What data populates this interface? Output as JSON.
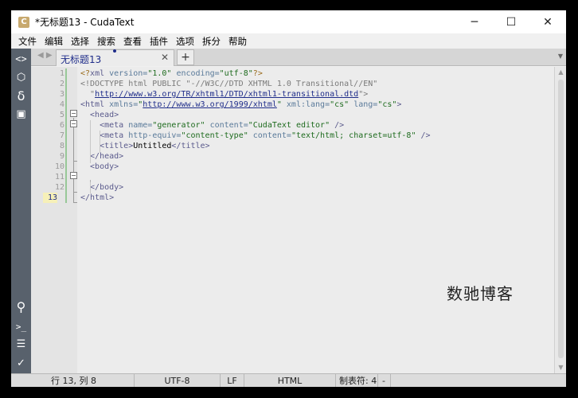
{
  "window": {
    "title": "*无标题13 - CudaText",
    "minimize_glyph": "─",
    "maximize_glyph": "☐",
    "close_glyph": "✕",
    "app_icon_letter": "C"
  },
  "menu": [
    "文件",
    "编辑",
    "选择",
    "搜索",
    "查看",
    "插件",
    "选项",
    "拆分",
    "帮助"
  ],
  "left_toolbar": {
    "top_icons": [
      {
        "name": "code-tree-icon",
        "glyph": "<>"
      },
      {
        "name": "project-icon",
        "glyph": "⬡"
      },
      {
        "name": "snippets-icon",
        "glyph": "δ"
      },
      {
        "name": "tabs-panel-icon",
        "glyph": "▣"
      }
    ],
    "bottom_icons": [
      {
        "name": "search-icon",
        "glyph": "⚲"
      },
      {
        "name": "console-icon",
        "glyph": ">_"
      },
      {
        "name": "output-icon",
        "glyph": "☰"
      },
      {
        "name": "validate-icon",
        "glyph": "✓"
      }
    ]
  },
  "tabs": {
    "nav_left": "◀",
    "nav_right": "▶",
    "active_label": "无标题13",
    "close_glyph": "✕",
    "add_glyph": "+",
    "more_glyph": "▼"
  },
  "editor": {
    "line_numbers": [
      "1",
      "2",
      "3",
      "4",
      "5",
      "6",
      "7",
      "8",
      "9",
      "10",
      "11",
      "12",
      "13"
    ],
    "current_line": "13",
    "lines": [
      [
        {
          "c": "t-pi",
          "t": "<?"
        },
        {
          "c": "t-tag",
          "t": "xml "
        },
        {
          "c": "t-attr",
          "t": "version="
        },
        {
          "c": "t-val",
          "t": "\"1.0\""
        },
        {
          "c": "t-attr",
          "t": " encoding="
        },
        {
          "c": "t-val",
          "t": "\"utf-8\""
        },
        {
          "c": "t-pi",
          "t": "?>"
        }
      ],
      [
        {
          "c": "t-doc",
          "t": "<!DOCTYPE html PUBLIC \"-//W3C//DTD XHTML 1.0 Transitional//EN\""
        }
      ],
      [
        {
          "c": "t-doc",
          "t": "  \""
        },
        {
          "c": "t-url",
          "t": "http://www.w3.org/TR/xhtml1/DTD/xhtml1-transitional.dtd"
        },
        {
          "c": "t-doc",
          "t": "\">"
        }
      ],
      [
        {
          "c": "t-tag",
          "t": "<html "
        },
        {
          "c": "t-attr",
          "t": "xmlns="
        },
        {
          "c": "t-val",
          "t": "\""
        },
        {
          "c": "t-url",
          "t": "http://www.w3.org/1999/xhtml"
        },
        {
          "c": "t-val",
          "t": "\""
        },
        {
          "c": "t-attr",
          "t": " xml:lang="
        },
        {
          "c": "t-val",
          "t": "\"cs\""
        },
        {
          "c": "t-attr",
          "t": " lang="
        },
        {
          "c": "t-val",
          "t": "\"cs\""
        },
        {
          "c": "t-tag",
          "t": ">"
        }
      ],
      [
        {
          "c": "t-tag",
          "t": "  <head>"
        }
      ],
      [
        {
          "c": "t-tag",
          "t": "    <meta "
        },
        {
          "c": "t-attr",
          "t": "name="
        },
        {
          "c": "t-val",
          "t": "\"generator\""
        },
        {
          "c": "t-attr",
          "t": " content="
        },
        {
          "c": "t-val",
          "t": "\"CudaText editor\""
        },
        {
          "c": "t-tag",
          "t": " />"
        }
      ],
      [
        {
          "c": "t-tag",
          "t": "    <meta "
        },
        {
          "c": "t-attr",
          "t": "http-equiv="
        },
        {
          "c": "t-val",
          "t": "\"content-type\""
        },
        {
          "c": "t-attr",
          "t": " content="
        },
        {
          "c": "t-val",
          "t": "\"text/html; charset=utf-8\""
        },
        {
          "c": "t-tag",
          "t": " />"
        }
      ],
      [
        {
          "c": "t-tag",
          "t": "    <title>"
        },
        {
          "c": "t-txt",
          "t": "Untitled"
        },
        {
          "c": "t-tag",
          "t": "</title>"
        }
      ],
      [
        {
          "c": "t-tag",
          "t": "  </head>"
        }
      ],
      [
        {
          "c": "t-tag",
          "t": "  <body>"
        }
      ],
      [
        {
          "c": "t-txt",
          "t": ""
        }
      ],
      [
        {
          "c": "t-tag",
          "t": "  </body>"
        }
      ],
      [
        {
          "c": "t-tag",
          "t": "</html>"
        }
      ]
    ],
    "watermark": "数驰博客"
  },
  "status": {
    "position": "行 13, 列 8",
    "encoding": "UTF-8",
    "line_ending": "LF",
    "lexer": "HTML",
    "tab_size": "制表符: 4",
    "extra": "-"
  },
  "colors": {
    "sidebar": "#58616c",
    "accent": "#1f2d8a",
    "current_line_highlight": "#f6f0b8"
  }
}
